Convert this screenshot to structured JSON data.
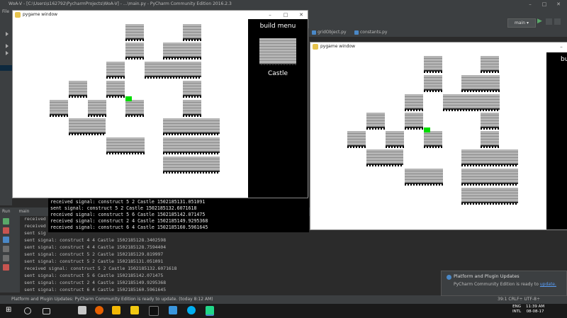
{
  "ide": {
    "title": "WoA-V - [C:\\Users\\s162792\\PycharmProjects\\WoA-V] - ...\\main.py - PyCharm Community Edition 2016.2.3",
    "menu_file": "File",
    "run_config": "main",
    "tabs": [
      {
        "label": "gridObject.py"
      },
      {
        "label": "constants.py"
      }
    ],
    "run_header": "Run",
    "run_tab": "main",
    "status_text": "Platform and Plugin Updates: PyCharm Community Edition is ready to update. (today 8:12 AM)",
    "status_right": "39:1  CRLF÷  UTF-8÷"
  },
  "console_lines": [
    "received",
    "received",
    "sent sig",
    "sent signal: construct 4 4 Castle 1502185128.3402598",
    "sent signal: construct 4 4 Castle 1502185128.7594404",
    "sent signal: construct 5 2 Castle 1502185129.819997",
    "sent signal: construct 5 2 Castle 1502185131.051091",
    "received signal: construct 5 2 Castle 1502185132.6071618",
    "sent signal: construct 5 6 Castle 1502185142.071475",
    "sent signal: construct 2 4 Castle 1502185149.9295368",
    "sent signal: construct 6 4 Castle 1502185160.5961645"
  ],
  "black_console_lines": [
    "received signal: construct 5 2 Castle 1502185131.051091",
    "sent signal: construct 5 2 Castle 1502185132.6071618",
    "received signal: construct 5 6 Castle 1502185142.071475",
    "received signal: construct 2 4 Castle 1502185149.9295368",
    "received signal: construct 6 4 Castle 1502185160.5961645"
  ],
  "pygame_left": {
    "title": "pygame window",
    "menu_title": "build menu",
    "menu_item": "Castle"
  },
  "pygame_right": {
    "title": "pygame window",
    "menu_title_partial": "bu"
  },
  "notification": {
    "title": "Platform and Plugin Updates",
    "text": "PyCharm Community Edition is ready to ",
    "link": "update."
  },
  "tray": {
    "lang_1": "ENG",
    "lang_2": "INTL",
    "time": "11:39 AM",
    "date": "08-08-17"
  },
  "colors": {
    "ide_bg": "#2b2b2b",
    "panel": "#3c3f41",
    "green_cell": "#00dd00",
    "accent": "#4a88c7"
  }
}
